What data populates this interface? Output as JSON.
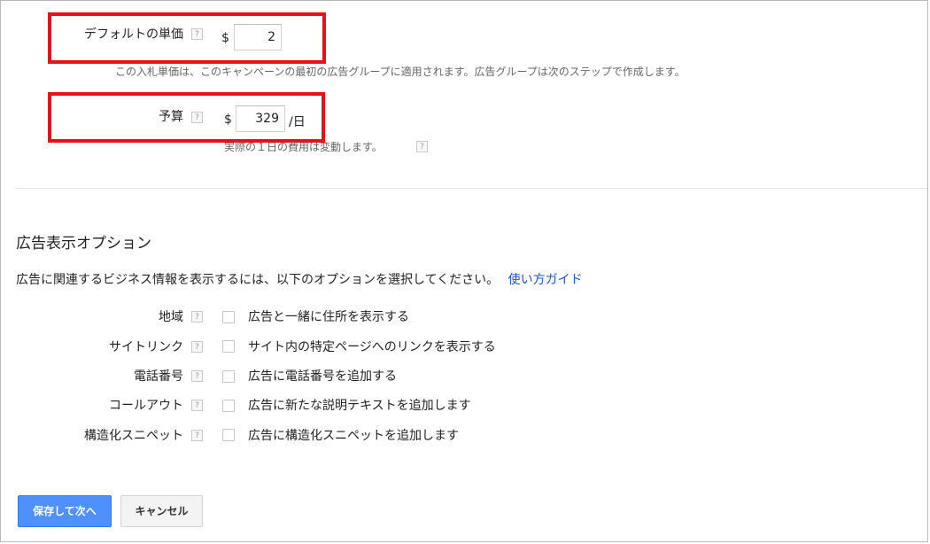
{
  "bid": {
    "label": "デフォルトの単価",
    "currency": "$",
    "value": "2",
    "hint": "この入札単価は、このキャンペーンの最初の広告グループに適用されます。広告グループは次のステップで作成します。"
  },
  "budget": {
    "label": "予算",
    "currency": "$",
    "value": "329",
    "unit": "/日",
    "hint": "実際の１日の費用は変動します。"
  },
  "help_glyph": "?",
  "ad_options": {
    "title": "広告表示オプション",
    "description": "広告に関連するビジネス情報を表示するには、以下のオプションを選択してください。",
    "guide_link": "使い方ガイド",
    "items": [
      {
        "label": "地域",
        "text": "広告と一緒に住所を表示する",
        "checked": false
      },
      {
        "label": "サイトリンク",
        "text": "サイト内の特定ページへのリンクを表示する",
        "checked": false
      },
      {
        "label": "電話番号",
        "text": "広告に電話番号を追加する",
        "checked": false
      },
      {
        "label": "コールアウト",
        "text": "広告に新たな説明テキストを追加します",
        "checked": false
      },
      {
        "label": "構造化スニペット",
        "text": "広告に構造化スニペットを追加します",
        "checked": false
      }
    ]
  },
  "actions": {
    "save_next": "保存して次へ",
    "cancel": "キャンセル"
  },
  "colors": {
    "highlight": "#e8111a",
    "primary_button": "#4d90fe",
    "link": "#1a57c9"
  }
}
